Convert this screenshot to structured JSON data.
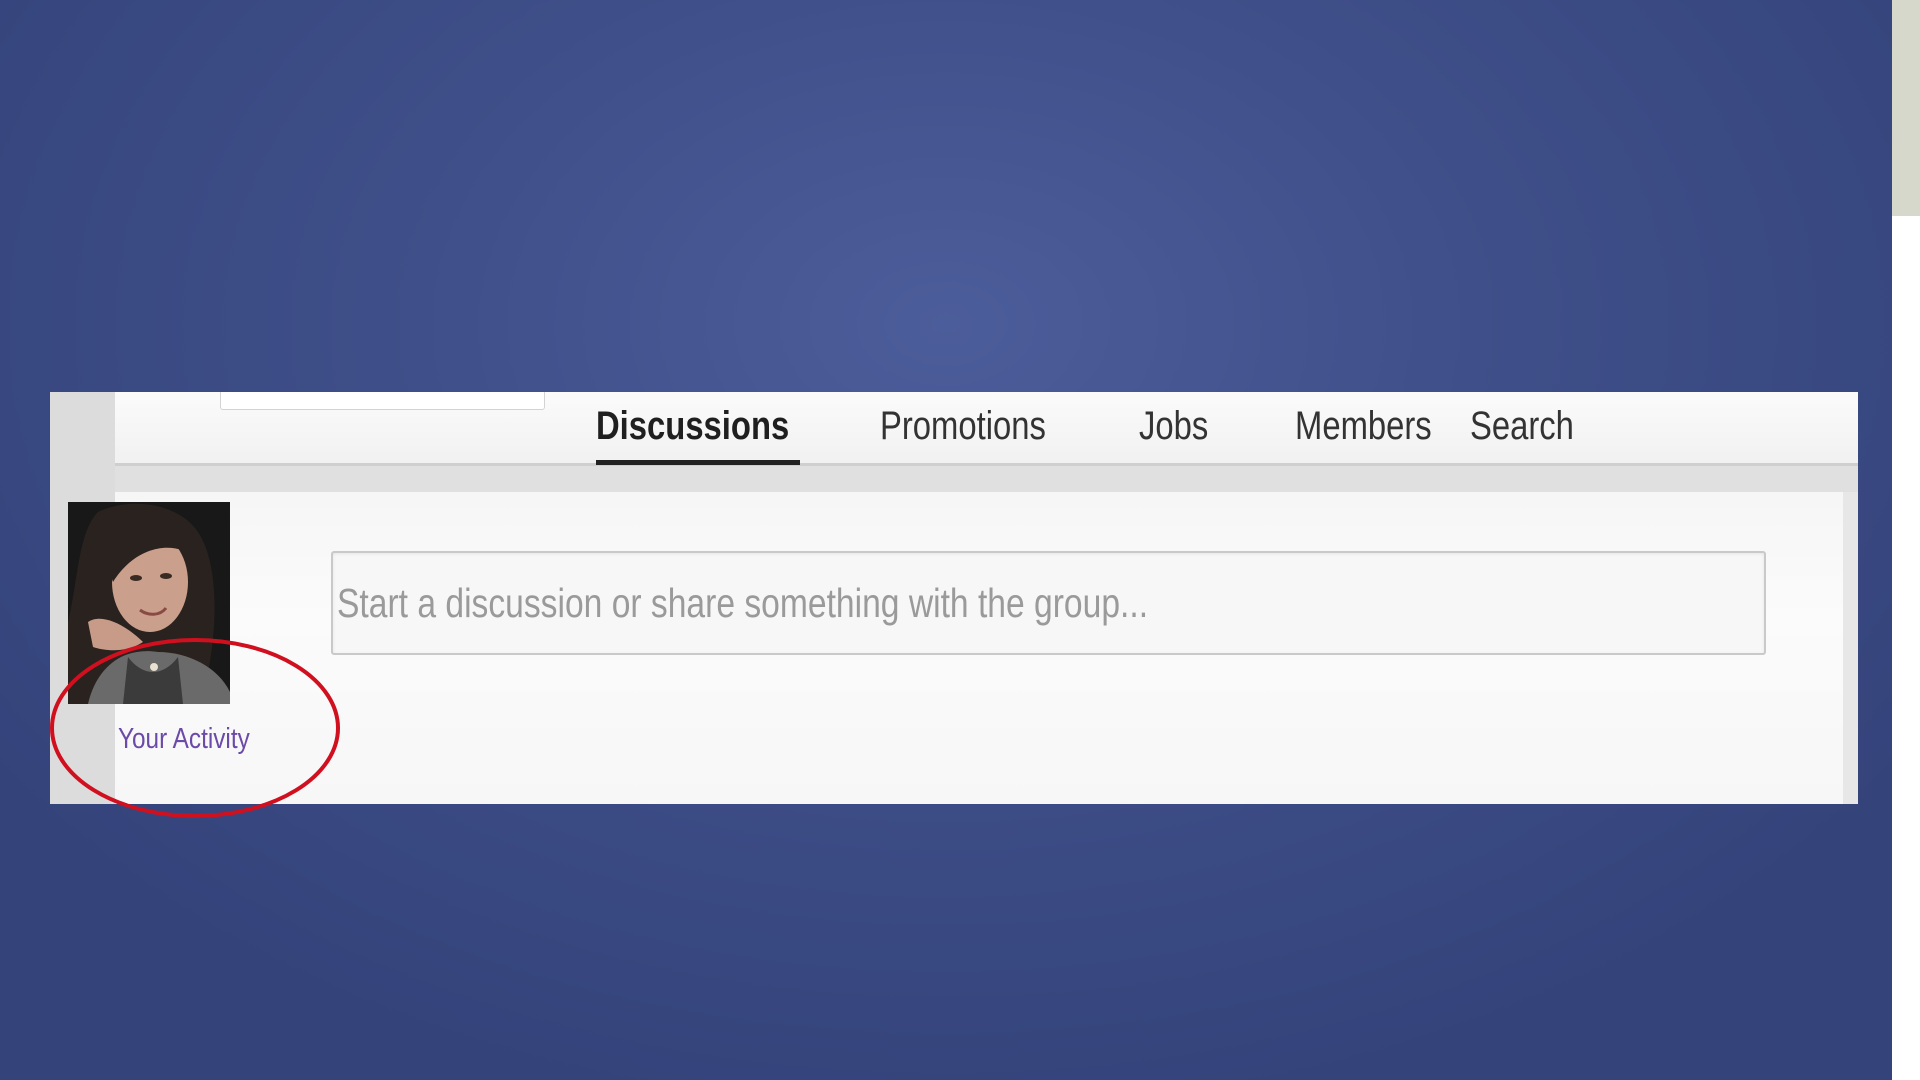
{
  "colors": {
    "slide_background": "#4c5d9b",
    "annotation_circle": "#d0101f",
    "activity_link": "#6b4aa8",
    "active_tab_underline": "#222222"
  },
  "nav": {
    "tabs": [
      {
        "label": "Discussions",
        "active": true
      },
      {
        "label": "Promotions",
        "active": false
      },
      {
        "label": "Jobs",
        "active": false
      },
      {
        "label": "Members",
        "active": false
      },
      {
        "label": "Search",
        "active": false
      }
    ]
  },
  "composer": {
    "placeholder": "Start a discussion or share something with the group..."
  },
  "sidebar": {
    "activity_label": "Your Activity",
    "avatar_icon": "user-photo"
  },
  "annotation": {
    "shape": "ellipse",
    "highlights": "Your Activity"
  }
}
